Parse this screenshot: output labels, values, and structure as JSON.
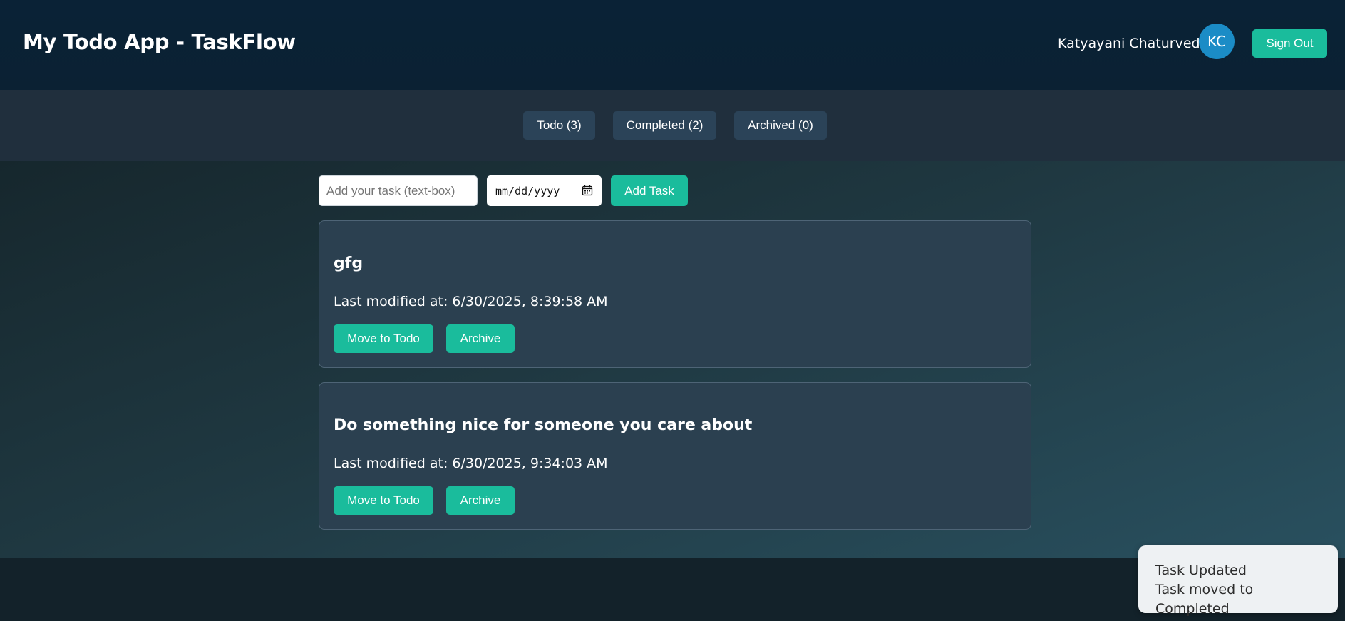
{
  "header": {
    "title": "My Todo App - TaskFlow",
    "user_name": "Katyayani Chaturvedi",
    "avatar_initials": "KC",
    "sign_out_label": "Sign Out"
  },
  "tabs": [
    {
      "label": "Todo (3)"
    },
    {
      "label": "Completed (2)"
    },
    {
      "label": "Archived (0)"
    }
  ],
  "add_form": {
    "task_placeholder": "Add your task (text-box)",
    "date_placeholder": "mm/dd/yyyy",
    "add_label": "Add Task"
  },
  "tasks": [
    {
      "title": "gfg",
      "modified": "Last modified at: 6/30/2025, 8:39:58 AM",
      "move_label": "Move to Todo",
      "archive_label": "Archive"
    },
    {
      "title": "Do something nice for someone you care about",
      "modified": "Last modified at: 6/30/2025, 9:34:03 AM",
      "move_label": "Move to Todo",
      "archive_label": "Archive"
    }
  ],
  "toast": {
    "title": "Task Updated",
    "message": "Task moved to Completed"
  },
  "colors": {
    "accent": "#1abc9c",
    "header_bg": "#0a2236",
    "tab_bg": "#2b4358",
    "avatar_bg": "#1b8cc6"
  },
  "icons": {
    "date_picker": "calendar-icon"
  }
}
